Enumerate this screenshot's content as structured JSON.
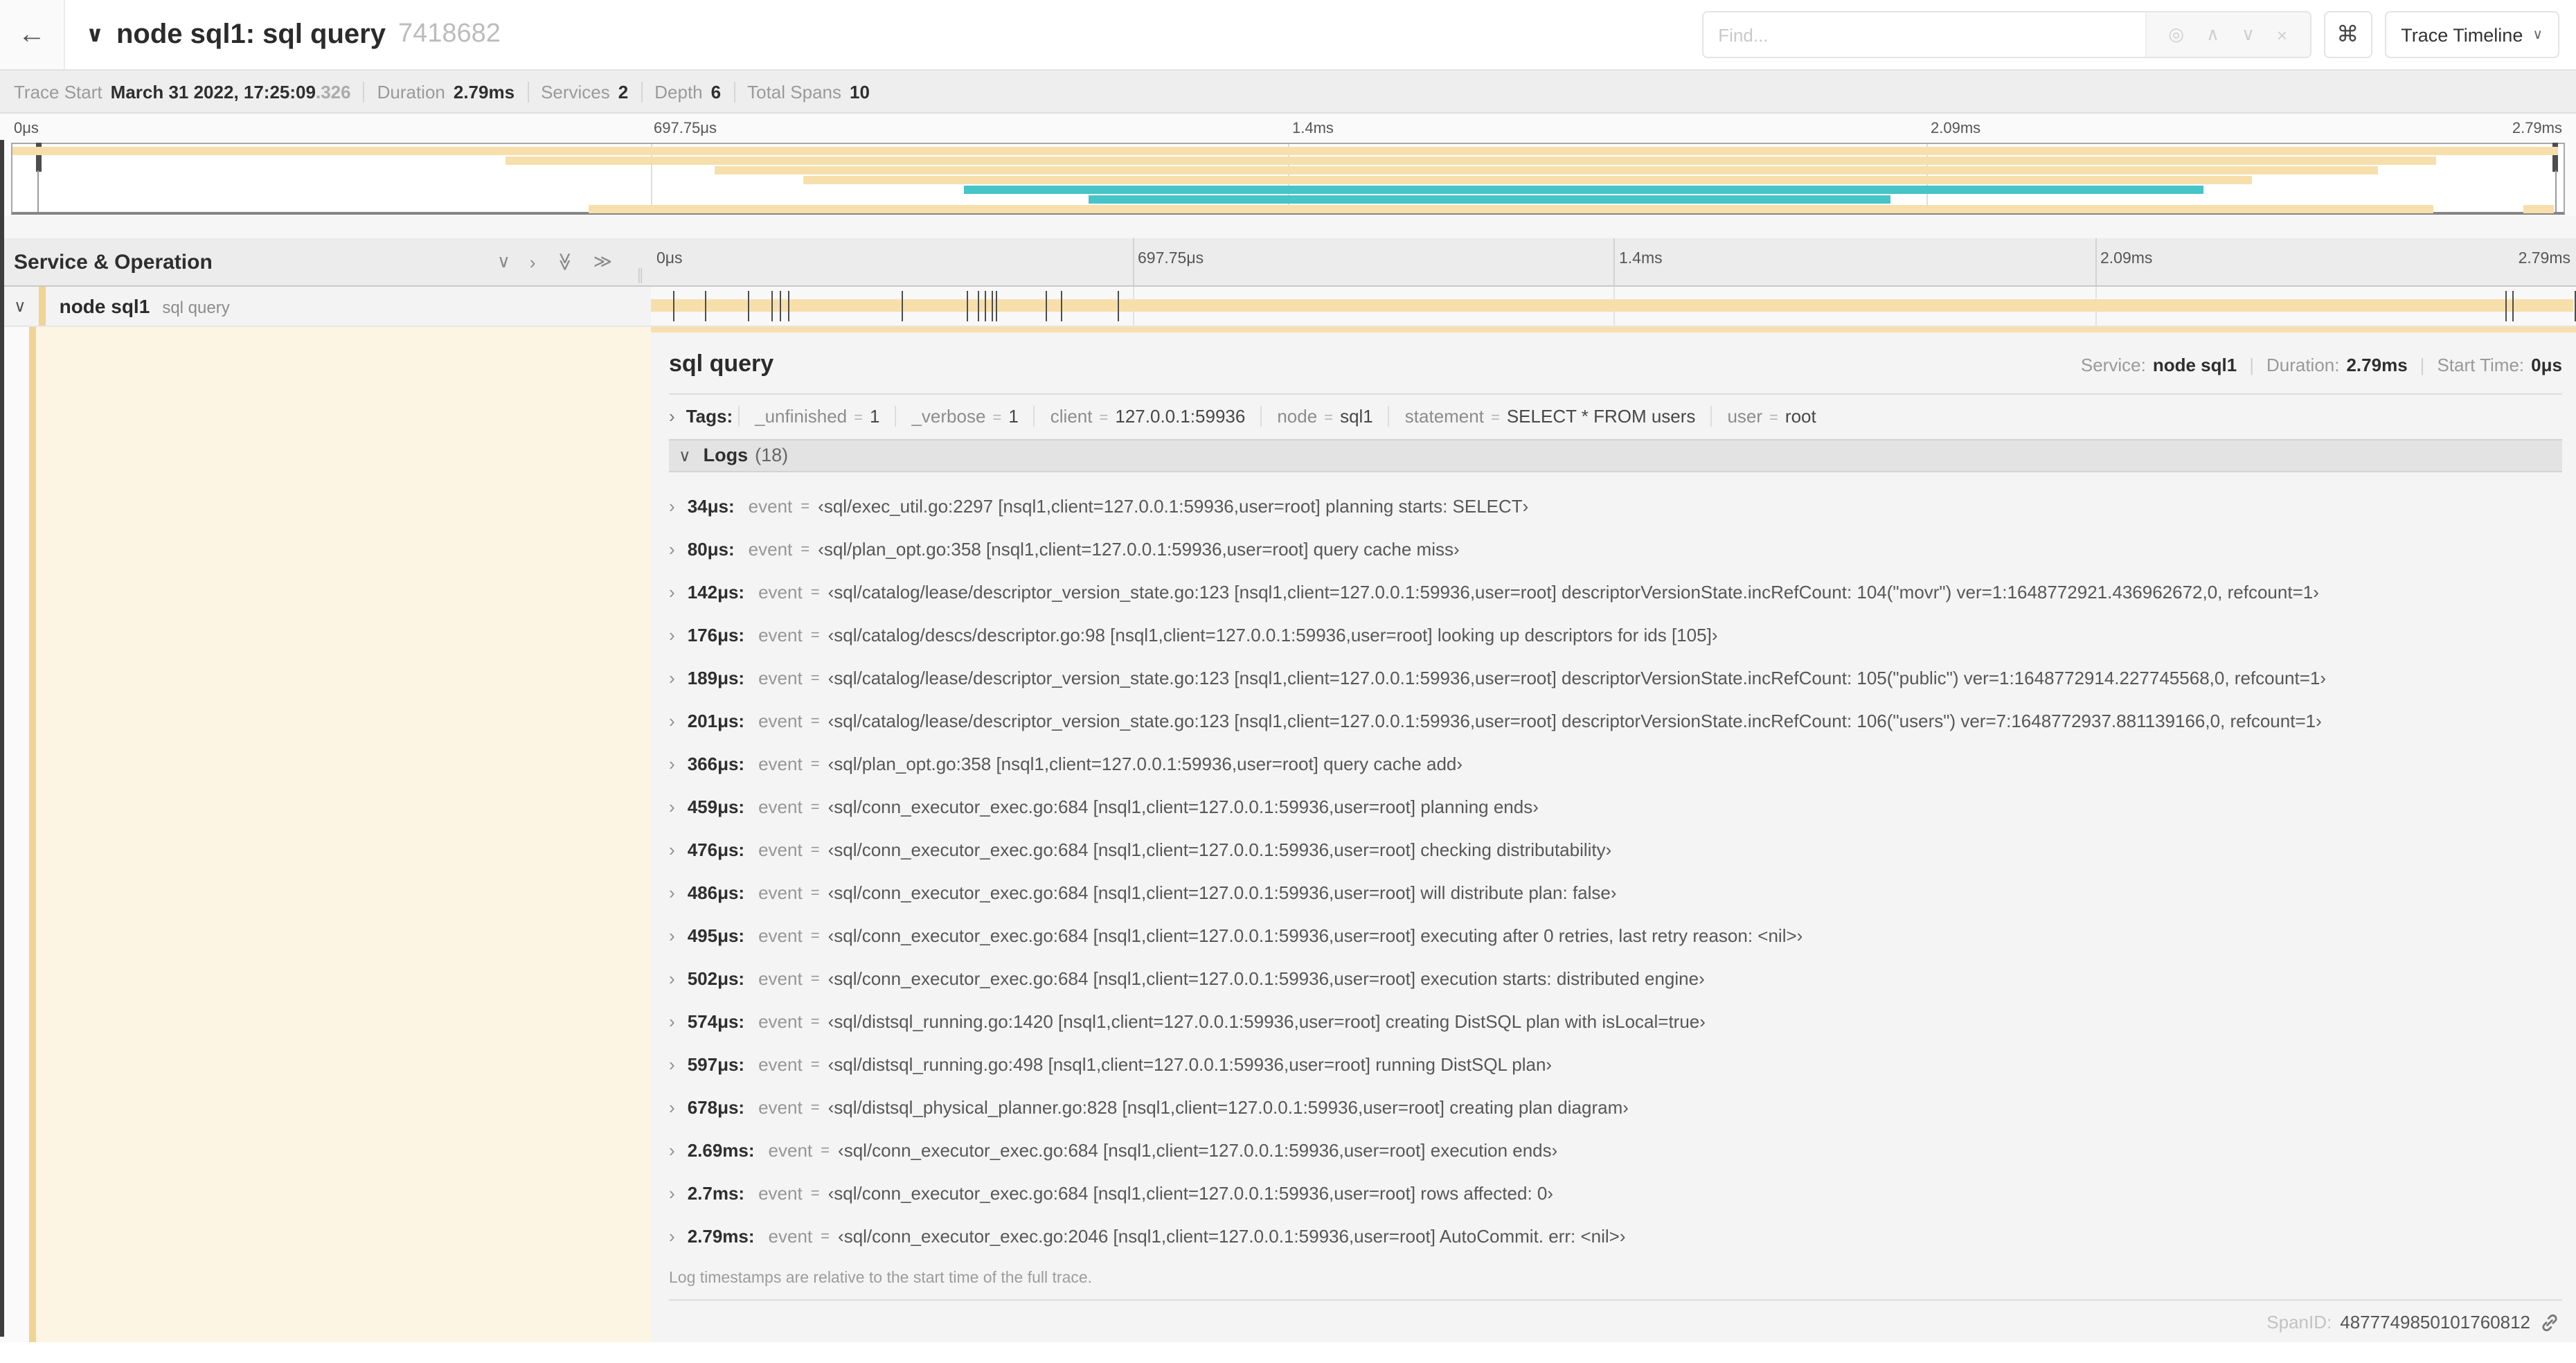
{
  "colors": {
    "span_tan": "#F7DFAC",
    "span_teal": "#45C5C7",
    "stripe_tan": "#F0D494",
    "cream": "#FCF5E3"
  },
  "header": {
    "back_label": "←",
    "title_caret": "∨",
    "title": "node sql1: sql query",
    "trace_id": "7418682",
    "find_placeholder": "Find...",
    "find_icons": {
      "locate": "◎",
      "prev": "∧",
      "next": "∨",
      "clear": "×"
    },
    "shortcut_label": "⌘",
    "view_button": "Trace Timeline",
    "view_caret": "∨"
  },
  "trace_info": {
    "items": [
      {
        "label": "Trace Start",
        "value": "March 31 2022, 17:25:09",
        "suffix": ".326"
      },
      {
        "label": "Duration",
        "value": "2.79ms"
      },
      {
        "label": "Services",
        "value": "2"
      },
      {
        "label": "Depth",
        "value": "6"
      },
      {
        "label": "Total Spans",
        "value": "10"
      }
    ]
  },
  "minimap": {
    "ticks": [
      "0μs",
      "697.75μs",
      "1.4ms",
      "2.09ms",
      "2.79ms"
    ],
    "bars": [
      {
        "row": 0,
        "start": 0,
        "end": 99.8,
        "color": "tan"
      },
      {
        "row": 1,
        "start": 19.3,
        "end": 95.0,
        "color": "tan"
      },
      {
        "row": 2,
        "start": 27.5,
        "end": 92.7,
        "color": "tan"
      },
      {
        "row": 3,
        "start": 31.0,
        "end": 87.8,
        "color": "tan"
      },
      {
        "row": 4,
        "start": 37.3,
        "end": 85.9,
        "color": "teal"
      },
      {
        "row": 5,
        "start": 42.2,
        "end": 73.6,
        "color": "teal"
      },
      {
        "row": 6,
        "start": 22.6,
        "end": 94.9,
        "color": "tan"
      },
      {
        "row": 6,
        "start": 98.4,
        "end": 99.6,
        "color": "tan"
      }
    ]
  },
  "timeline": {
    "header_label": "Service & Operation",
    "collapse_icons": [
      "∨",
      "›",
      "≫",
      "≫"
    ],
    "resizer": "∥",
    "ticks": [
      "0μs",
      "697.75μs",
      "1.4ms",
      "2.09ms",
      "2.79ms"
    ],
    "duration_us": 2790
  },
  "span_row": {
    "caret": "∨",
    "service": "node sql1",
    "operation": "sql query"
  },
  "detail": {
    "operation": "sql query",
    "service_label": "Service:",
    "service": "node sql1",
    "duration_label": "Duration:",
    "duration": "2.79ms",
    "start_label": "Start Time:",
    "start": "0μs",
    "expander": "›",
    "tags_caret": "›",
    "tags_label": "Tags:",
    "tags": [
      {
        "key": "_unfinished",
        "value": "1"
      },
      {
        "key": "_verbose",
        "value": "1"
      },
      {
        "key": "client",
        "value": "127.0.0.1:59936"
      },
      {
        "key": "node",
        "value": "sql1"
      },
      {
        "key": "statement",
        "value": "SELECT * FROM users"
      },
      {
        "key": "user",
        "value": "root"
      }
    ],
    "logs_caret": "∨",
    "logs_label": "Logs",
    "logs_count": "(18)",
    "logs": [
      {
        "t_us": 34,
        "time": "34μs:",
        "field": "event",
        "value": "‹sql/exec_util.go:2297 [nsql1,client=127.0.0.1:59936,user=root] planning starts: SELECT›"
      },
      {
        "t_us": 80,
        "time": "80μs:",
        "field": "event",
        "value": "‹sql/plan_opt.go:358 [nsql1,client=127.0.0.1:59936,user=root] query cache miss›"
      },
      {
        "t_us": 142,
        "time": "142μs:",
        "field": "event",
        "value": "‹sql/catalog/lease/descriptor_version_state.go:123 [nsql1,client=127.0.0.1:59936,user=root] descriptorVersionState.incRefCount: 104(\"movr\") ver=1:1648772921.436962672,0, refcount=1›"
      },
      {
        "t_us": 176,
        "time": "176μs:",
        "field": "event",
        "value": "‹sql/catalog/descs/descriptor.go:98 [nsql1,client=127.0.0.1:59936,user=root] looking up descriptors for ids [105]›"
      },
      {
        "t_us": 189,
        "time": "189μs:",
        "field": "event",
        "value": "‹sql/catalog/lease/descriptor_version_state.go:123 [nsql1,client=127.0.0.1:59936,user=root] descriptorVersionState.incRefCount: 105(\"public\") ver=1:1648772914.227745568,0, refcount=1›"
      },
      {
        "t_us": 201,
        "time": "201μs:",
        "field": "event",
        "value": "‹sql/catalog/lease/descriptor_version_state.go:123 [nsql1,client=127.0.0.1:59936,user=root] descriptorVersionState.incRefCount: 106(\"users\") ver=7:1648772937.881139166,0, refcount=1›"
      },
      {
        "t_us": 366,
        "time": "366μs:",
        "field": "event",
        "value": "‹sql/plan_opt.go:358 [nsql1,client=127.0.0.1:59936,user=root] query cache add›"
      },
      {
        "t_us": 459,
        "time": "459μs:",
        "field": "event",
        "value": "‹sql/conn_executor_exec.go:684 [nsql1,client=127.0.0.1:59936,user=root] planning ends›"
      },
      {
        "t_us": 476,
        "time": "476μs:",
        "field": "event",
        "value": "‹sql/conn_executor_exec.go:684 [nsql1,client=127.0.0.1:59936,user=root] checking distributability›"
      },
      {
        "t_us": 486,
        "time": "486μs:",
        "field": "event",
        "value": "‹sql/conn_executor_exec.go:684 [nsql1,client=127.0.0.1:59936,user=root] will distribute plan: false›"
      },
      {
        "t_us": 495,
        "time": "495μs:",
        "field": "event",
        "value": "‹sql/conn_executor_exec.go:684 [nsql1,client=127.0.0.1:59936,user=root] executing after 0 retries, last retry reason: <nil>›"
      },
      {
        "t_us": 502,
        "time": "502μs:",
        "field": "event",
        "value": "‹sql/conn_executor_exec.go:684 [nsql1,client=127.0.0.1:59936,user=root] execution starts: distributed engine›"
      },
      {
        "t_us": 574,
        "time": "574μs:",
        "field": "event",
        "value": "‹sql/distsql_running.go:1420 [nsql1,client=127.0.0.1:59936,user=root] creating DistSQL plan with isLocal=true›"
      },
      {
        "t_us": 597,
        "time": "597μs:",
        "field": "event",
        "value": "‹sql/distsql_running.go:498 [nsql1,client=127.0.0.1:59936,user=root] running DistSQL plan›"
      },
      {
        "t_us": 678,
        "time": "678μs:",
        "field": "event",
        "value": "‹sql/distsql_physical_planner.go:828 [nsql1,client=127.0.0.1:59936,user=root] creating plan diagram›"
      },
      {
        "t_us": 2690,
        "time": "2.69ms:",
        "field": "event",
        "value": "‹sql/conn_executor_exec.go:684 [nsql1,client=127.0.0.1:59936,user=root] execution ends›"
      },
      {
        "t_us": 2700,
        "time": "2.7ms:",
        "field": "event",
        "value": "‹sql/conn_executor_exec.go:684 [nsql1,client=127.0.0.1:59936,user=root] rows affected: 0›"
      },
      {
        "t_us": 2790,
        "time": "2.79ms:",
        "field": "event",
        "value": "‹sql/conn_executor_exec.go:2046 [nsql1,client=127.0.0.1:59936,user=root] AutoCommit. err: <nil>›"
      }
    ],
    "logs_footer": "Log timestamps are relative to the start time of the full trace.",
    "spanid_label": "SpanID:",
    "spanid": "4877749850101760812"
  }
}
